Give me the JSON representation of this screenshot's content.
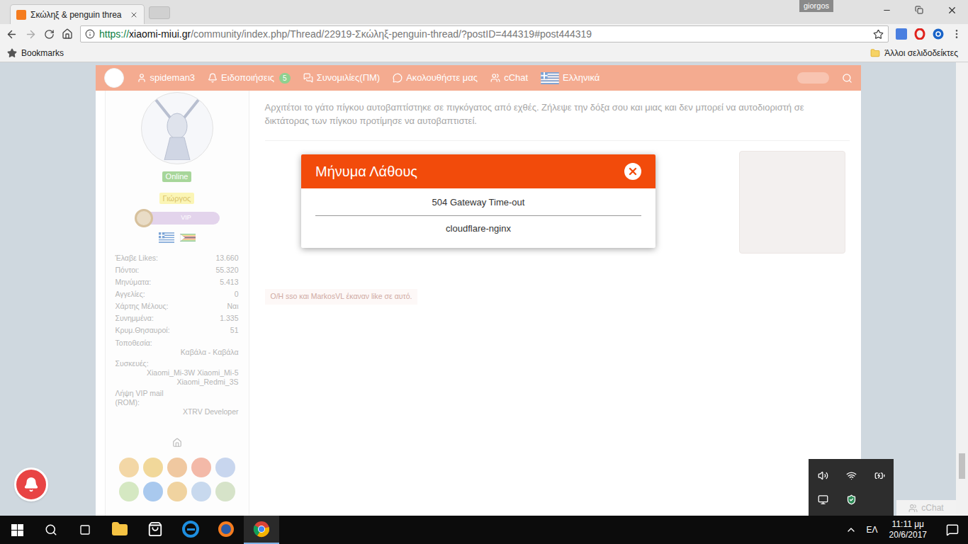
{
  "browser": {
    "tab_title": "Σκώληξ & penguin threa",
    "profile": "giorgos",
    "url_scheme": "https://",
    "url_host": "xiaomi-miui.gr",
    "url_path": "/community/index.php/Thread/22919-Σκώληξ-penguin-thread/?postID=444319#post444319",
    "bookmarks_label": "Bookmarks",
    "other_bookmarks": "Άλλοι σελιδοδείκτες"
  },
  "nav": {
    "items": [
      {
        "label": "spideman3",
        "icon": "user"
      },
      {
        "label": "Ειδοποιήσεις",
        "icon": "bell",
        "badge": "5"
      },
      {
        "label": "Συνομιλίες(ΠΜ)",
        "icon": "messages"
      },
      {
        "label": "Ακολουθήστε μας",
        "icon": "follow"
      },
      {
        "label": "cChat",
        "icon": "users"
      },
      {
        "label": "Ελληνικά",
        "icon": "flag"
      }
    ]
  },
  "user": {
    "status": "Online",
    "name": "Γιώργος",
    "rank": "VIP",
    "stats": [
      {
        "kind": "inline",
        "label": "Έλαβε Likes:",
        "value": [
          "13.660"
        ]
      },
      {
        "kind": "inline",
        "label": "Πόντοι:",
        "value": [
          "55.320"
        ]
      },
      {
        "kind": "inline",
        "label": "Μηνύματα:",
        "value": [
          "5.413"
        ]
      },
      {
        "kind": "inline",
        "label": "Αγγελίες:",
        "value": [
          "0"
        ]
      },
      {
        "kind": "inline",
        "label": "Χάρτης Μέλους:",
        "value": [
          "Ναι"
        ]
      },
      {
        "kind": "inline",
        "label": "Συνημμένα:",
        "value": [
          "1.335"
        ]
      },
      {
        "kind": "inline",
        "label": "Κρυμ.Θησαυροί:",
        "value": [
          "51"
        ]
      },
      {
        "kind": "stacked",
        "label": "Τοποθεσία:",
        "value": [
          "Καβάλα - Καβάλα"
        ]
      },
      {
        "kind": "stacked",
        "label": "Συσκευές:",
        "value": [
          "Xiaomi_Mi-3W Xiaomi_Mi-5",
          "Xiaomi_Redmi_3S"
        ]
      },
      {
        "kind": "stacked",
        "label": "Λήψη VIP mail (ROM):",
        "value": [
          "XTRV Developer"
        ]
      }
    ]
  },
  "post": {
    "text": "Αρχιτέτοι το γάτο πίγκου αυτοβαπτίστηκε σε πιγκόγατος από εχθές. Ζήλεψε την δόξα σου και μιας και δεν μπορεί να αυτοδιοριστή σε δικτάτορας των πίγκου προτίμησε να αυτοβαπτιστεί.",
    "likes": "O/H sso και MarkosVL έκαναν like σε αυτό."
  },
  "dialog": {
    "title": "Μήνυμα Λάθους",
    "message": "504 Gateway Time-out",
    "server": "cloudflare-nginx"
  },
  "chat": {
    "label": "cChat"
  },
  "taskbar": {
    "language": "ΕΛ",
    "time": "11:11 μμ",
    "date": "20/6/2017",
    "apps": [
      {
        "kind": "explorer",
        "active": false
      },
      {
        "kind": "store",
        "active": false
      },
      {
        "kind": "edge",
        "active": false
      },
      {
        "kind": "firefox",
        "active": false
      },
      {
        "kind": "chrome",
        "active": true
      }
    ]
  }
}
